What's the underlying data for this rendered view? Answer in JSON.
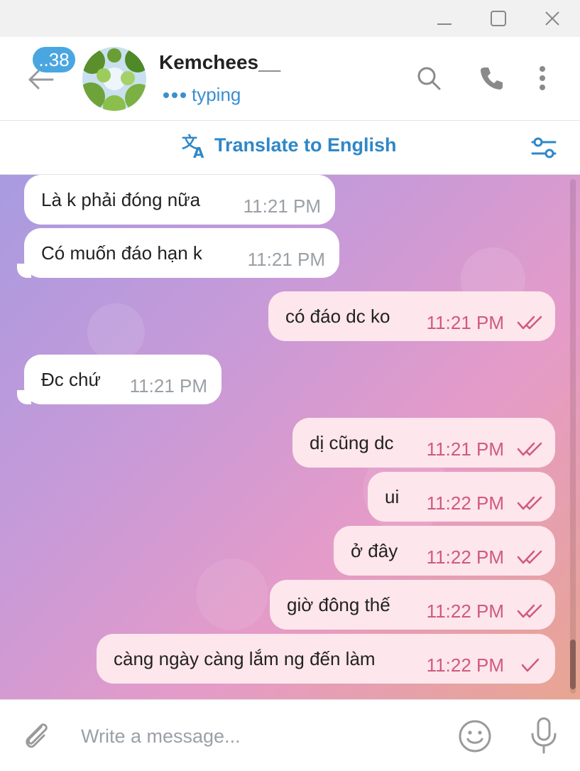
{
  "window": {
    "controls": [
      "minimize-icon",
      "maximize-icon",
      "close-icon"
    ]
  },
  "header": {
    "unread_count": "..38",
    "contact_name": "Kemchees__",
    "status": "typing",
    "icons": [
      "back-arrow-icon",
      "search-icon",
      "phone-icon",
      "more-vertical-icon"
    ]
  },
  "translate": {
    "label": "Translate to English",
    "icons": [
      "translate-icon",
      "settings-sliders-icon"
    ]
  },
  "messages": [
    {
      "direction": "in",
      "text": "Là k phải đóng nữa",
      "time": "11:21 PM"
    },
    {
      "direction": "in",
      "text": "Có muốn đáo hạn k",
      "time": "11:21 PM"
    },
    {
      "direction": "out",
      "text": "có đáo dc ko",
      "time": "11:21 PM",
      "status": "read"
    },
    {
      "direction": "in",
      "text": "Đc chứ",
      "time": "11:21 PM"
    },
    {
      "direction": "out",
      "text": "dị cũng dc",
      "time": "11:21 PM",
      "status": "read"
    },
    {
      "direction": "out",
      "text": "ui",
      "time": "11:22 PM",
      "status": "read"
    },
    {
      "direction": "out",
      "text": "ở đây",
      "time": "11:22 PM",
      "status": "read"
    },
    {
      "direction": "out",
      "text": "giờ đông thế",
      "time": "11:22 PM",
      "status": "read"
    },
    {
      "direction": "out",
      "text": "càng ngày càng lắm ng đến làm",
      "time": "11:22 PM",
      "status": "sent"
    }
  ],
  "composer": {
    "placeholder": "Write a message...",
    "icons": [
      "paperclip-icon",
      "emoji-icon",
      "microphone-icon"
    ]
  },
  "colors": {
    "accent": "#3a8fd0",
    "badge": "#4aa6e0",
    "outgoing_bubble": "#fde6ec",
    "outgoing_time": "#d05a7c",
    "incoming_bubble": "#ffffff"
  }
}
